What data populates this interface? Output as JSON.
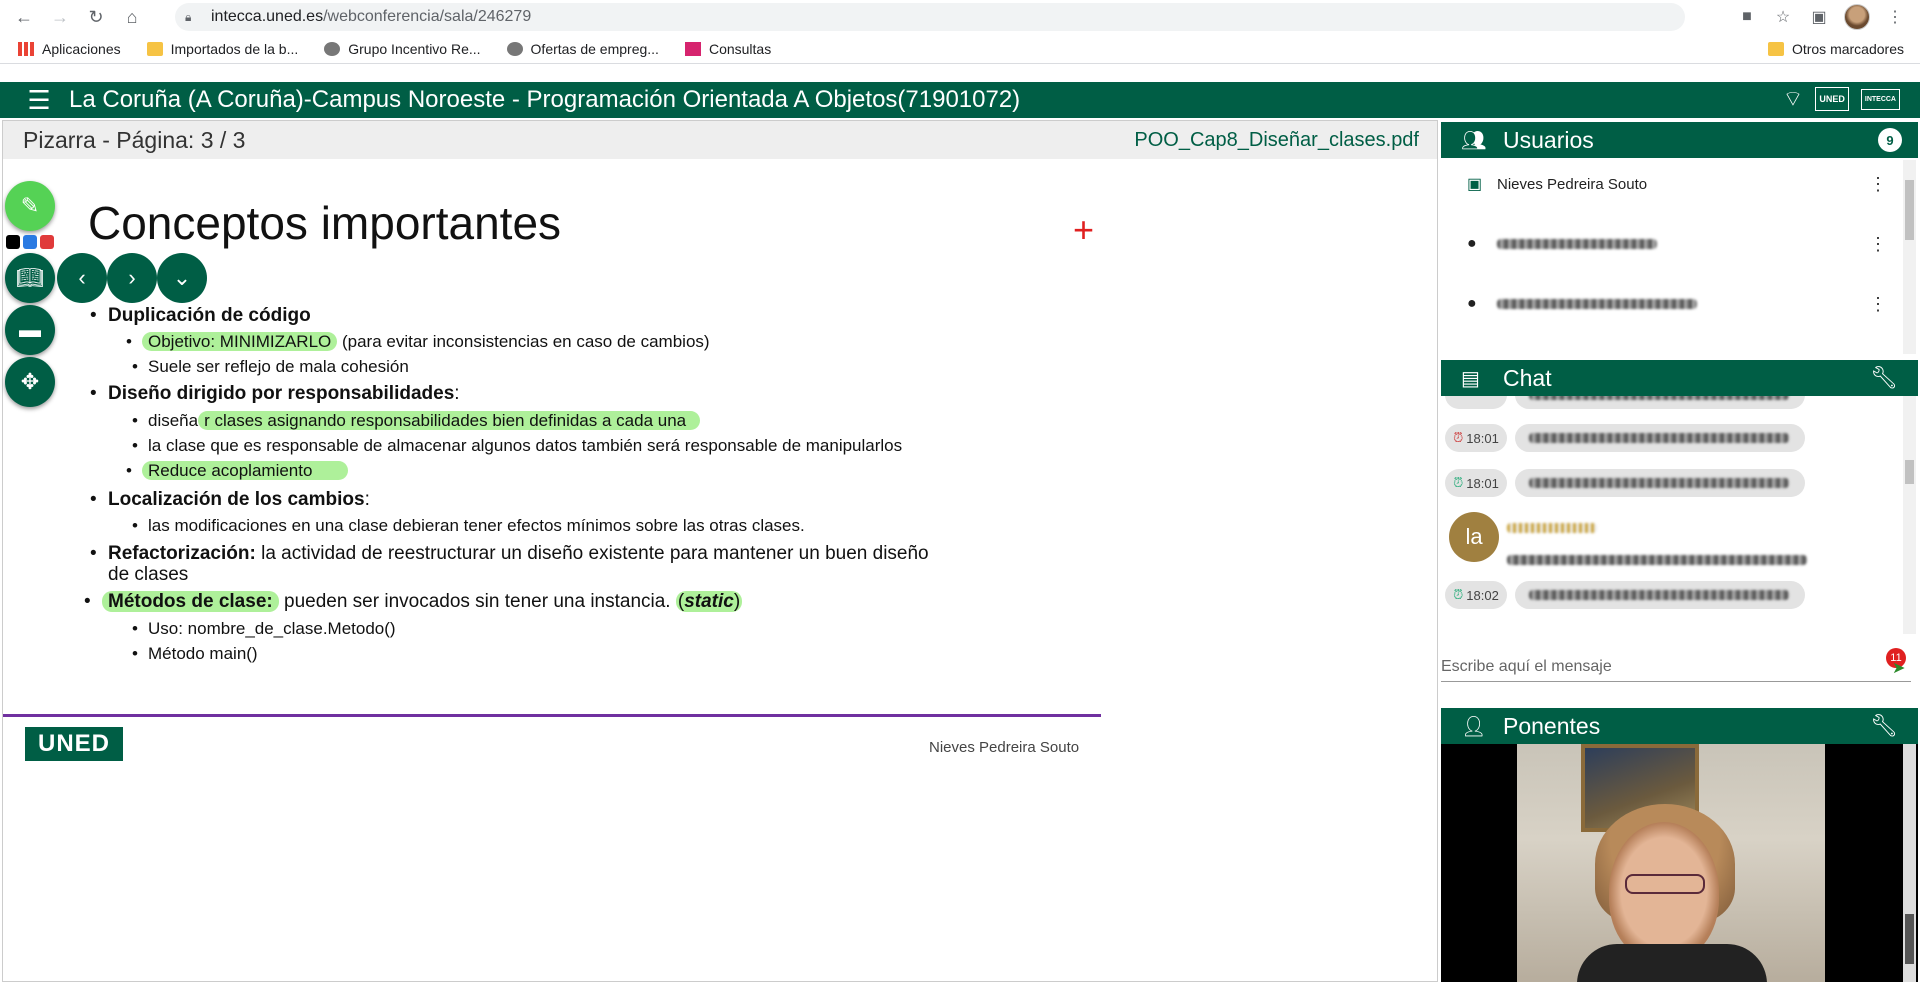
{
  "browser": {
    "url_host": "intecca.uned.es",
    "url_path": "/webconferencia/sala/246279",
    "bookmarks": [
      "Aplicaciones",
      "Importados de la b...",
      "Grupo Incentivo Re...",
      "Ofertas de empreg...",
      "Consultas"
    ],
    "other_bookmarks": "Otros marcadores"
  },
  "header": {
    "title": "La Coruña (A Coruña)-Campus Noroeste - Programación Orientada A Objetos(71901072)",
    "logo_text": "UNED",
    "logo_text2": "INTECCA"
  },
  "whiteboard": {
    "title": "Pizarra - Página: 3 / 3",
    "file": "POO_Cap8_Diseñar_clases.pdf"
  },
  "slide": {
    "heading": "Conceptos importantes",
    "b1": "Duplicación de código",
    "b1_s1_hl": "Objetivo: MINIMIZARLO",
    "b1_s1_rest": " (para evitar inconsistencias en caso de cambios)",
    "b1_s2": "Suele ser reflejo de mala cohesión",
    "b2": "Diseño dirigido por responsabilidades",
    "b2_colon": ":",
    "b2_s1_pre": "diseña",
    "b2_s1_hl": "r clases asignando responsabilidades bien definidas a cada una",
    "b2_s2": "la clase que es responsable de almacenar algunos datos también será responsable de manipularlos",
    "b2_s3_hl": "Reduce acoplamiento",
    "b3": "Localización de los cambios",
    "b3_colon": ":",
    "b3_s1": "las modificaciones en una clase debieran tener efectos mínimos sobre las otras clases.",
    "b4_bold": "Refactorización:",
    "b4_rest": " la actividad de reestructurar un diseño existente para mantener un buen diseño",
    "b4_line2": "de clases",
    "b5_hl": "Métodos de clase:",
    "b5_rest": " pueden ser invocados sin tener una instancia. ",
    "b5_static_open": "(",
    "b5_static": "static",
    "b5_static_close": ")",
    "b5_s1": "Uso: nombre_de_clase.Metodo()",
    "b5_s2": "Método main()",
    "footer_logo": "UNED",
    "author": "Nieves Pedreira  Souto"
  },
  "users": {
    "title": "Usuarios",
    "count": "9",
    "first_user": "Nieves Pedreira Souto"
  },
  "chat": {
    "title": "Chat",
    "messages": [
      {
        "time": "18:01"
      },
      {
        "time": "18:01"
      },
      {
        "time": "18:02"
      }
    ],
    "avatar_initials": "la",
    "input_placeholder": "Escribe aquí el mensaje",
    "unread_count": "11"
  },
  "ponentes": {
    "title": "Ponentes"
  },
  "colors": {
    "brand": "#005e45",
    "highlight": "#aef09a",
    "divider": "#7030a0"
  }
}
